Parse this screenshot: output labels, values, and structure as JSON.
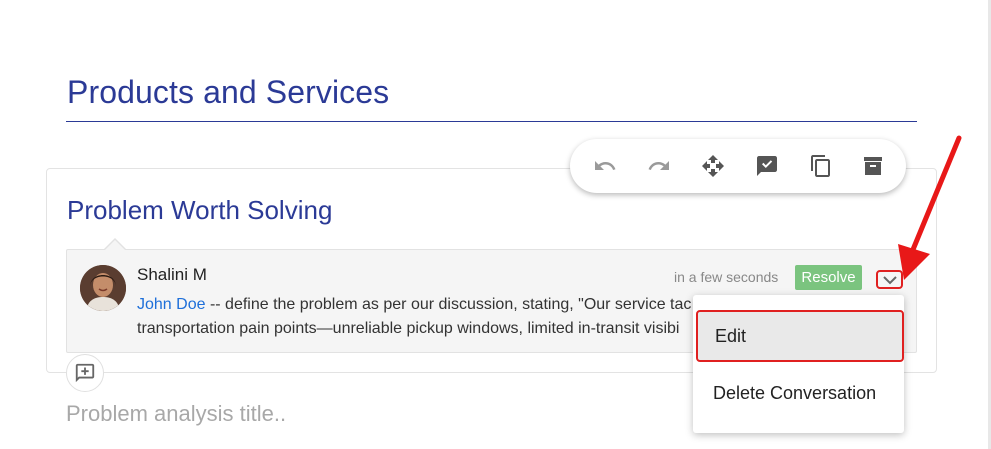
{
  "page": {
    "title": "Products and Services"
  },
  "section": {
    "title": "Problem Worth Solving",
    "placeholder": "Problem analysis title.."
  },
  "toolbar": {
    "buttons": [
      {
        "icon": "undo-icon"
      },
      {
        "icon": "redo-icon"
      },
      {
        "icon": "move-icon"
      },
      {
        "icon": "comment-check-icon"
      },
      {
        "icon": "copy-icon"
      },
      {
        "icon": "archive-icon"
      }
    ]
  },
  "comment": {
    "author": "Shalini M",
    "timestamp": "in a few seconds",
    "resolve_label": "Resolve",
    "mention": "John Doe",
    "text_line1": " -- define the problem as per our discussion, stating, \"Our service tac",
    "text_line2": "transportation pain points—unreliable pickup windows, limited in-transit visibi"
  },
  "menu": {
    "items": [
      {
        "label": "Edit"
      },
      {
        "label": "Delete Conversation"
      }
    ]
  },
  "colors": {
    "accent": "#2b3a96",
    "resolve": "#7bc47f",
    "highlight": "#e02020",
    "mention": "#1e6fd9"
  }
}
